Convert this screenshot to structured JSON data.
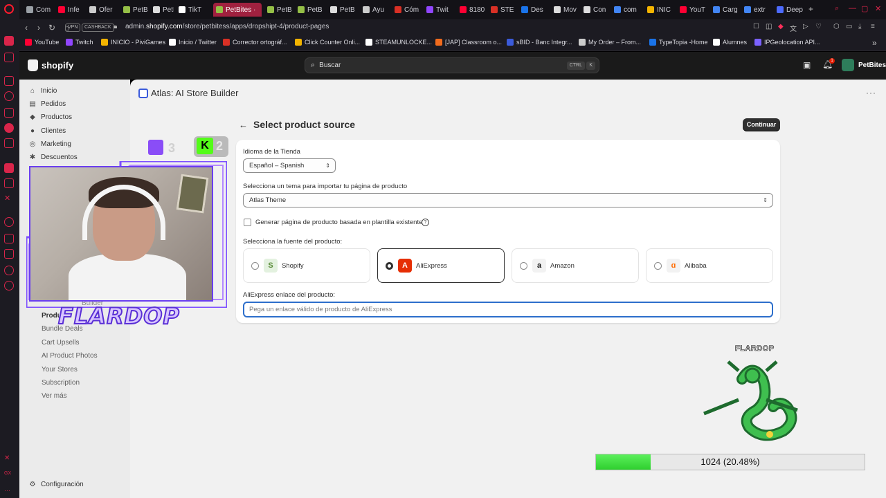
{
  "browser": {
    "tabs": [
      {
        "label": "Com",
        "active": false,
        "color": "#9aa0a6"
      },
      {
        "label": "Infe",
        "active": false,
        "color": "#ff0033"
      },
      {
        "label": "Ofer",
        "active": false,
        "color": "#cccccc"
      },
      {
        "label": "PetB",
        "active": false,
        "color": "#95bf47"
      },
      {
        "label": "PetB",
        "active": false,
        "color": "#dddddd"
      },
      {
        "label": "TikT",
        "active": false,
        "color": "#ffffff"
      },
      {
        "label": "PetBites ·",
        "active": true,
        "color": "#95bf47"
      },
      {
        "label": "PetB",
        "active": false,
        "color": "#95bf47"
      },
      {
        "label": "PetB",
        "active": false,
        "color": "#95bf47"
      },
      {
        "label": "PetB",
        "active": false,
        "color": "#dddddd"
      },
      {
        "label": "Ayu",
        "active": false,
        "color": "#cccccc"
      },
      {
        "label": "Cóm",
        "active": false,
        "color": "#d93025"
      },
      {
        "label": "Twit",
        "active": false,
        "color": "#9146ff"
      },
      {
        "label": "8180",
        "active": false,
        "color": "#ff0033"
      },
      {
        "label": "STE",
        "active": false,
        "color": "#d93025"
      },
      {
        "label": "Des",
        "active": false,
        "color": "#1a73e8"
      },
      {
        "label": "Mov",
        "active": false,
        "color": "#dddddd"
      },
      {
        "label": "Con",
        "active": false,
        "color": "#dddddd"
      },
      {
        "label": "com",
        "active": false,
        "color": "#4285f4"
      },
      {
        "label": "INIC",
        "active": false,
        "color": "#f4b400"
      },
      {
        "label": "YouT",
        "active": false,
        "color": "#ff0033"
      },
      {
        "label": "Carg",
        "active": false,
        "color": "#4285f4"
      },
      {
        "label": "extr",
        "active": false,
        "color": "#4285f4"
      },
      {
        "label": "Deep",
        "active": false,
        "color": "#4d6bfe"
      }
    ],
    "new_tab_label": "+",
    "badges": {
      "vpn": "VPN",
      "cashback": "CASHBACK"
    },
    "url_prefix": "admin.",
    "url_host": "shopify.com",
    "url_path": "/store/petbitess/apps/dropshipt-4/product-pages",
    "bookmarks": [
      {
        "label": "YouTube",
        "color": "#ff0033"
      },
      {
        "label": "Twitch",
        "color": "#9146ff"
      },
      {
        "label": "INICIO - PiviGames",
        "color": "#f4b400"
      },
      {
        "label": "Inicio / Twitter",
        "color": "#ffffff"
      },
      {
        "label": "Corrector ortográf...",
        "color": "#d93025"
      },
      {
        "label": "Click Counter Onli...",
        "color": "#f4b400"
      },
      {
        "label": "STEAMUNLOCKE...",
        "color": "#ffffff"
      },
      {
        "label": "[JAP] Classroom o...",
        "color": "#f26b1d"
      },
      {
        "label": "sBID - Banc Integr...",
        "color": "#3b5bdb"
      },
      {
        "label": "My Order – From...",
        "color": "#cccccc"
      },
      {
        "label": "TypeTopia -Home",
        "color": "#1a73e8"
      },
      {
        "label": "Alumnes",
        "color": "#ffffff"
      },
      {
        "label": "IPGeolocation API...",
        "color": "#7b61ff"
      }
    ]
  },
  "shopify": {
    "logo_text": "shopify",
    "search_placeholder": "Buscar",
    "search_kbd_1": "CTRL",
    "search_kbd_2": "K",
    "store_name": "PetBites",
    "notification_count": "1"
  },
  "nav": {
    "items": [
      {
        "label": "Inicio",
        "icon": "home-icon",
        "glyph": "⌂"
      },
      {
        "label": "Pedidos",
        "icon": "orders-icon",
        "glyph": "▤"
      },
      {
        "label": "Productos",
        "icon": "tag-icon",
        "glyph": "◆"
      },
      {
        "label": "Clientes",
        "icon": "person-icon",
        "glyph": "●"
      },
      {
        "label": "Marketing",
        "icon": "target-icon",
        "glyph": "◎"
      },
      {
        "label": "Descuentos",
        "icon": "discount-icon",
        "glyph": "✱"
      }
    ],
    "app_sub": [
      "Produ",
      "Bundle Deals",
      "Cart Upsells",
      "AI Product Photos",
      "Your Stores",
      "Subscription",
      "Ver más"
    ],
    "builder_label": "Builder",
    "settings": "Configuración"
  },
  "app": {
    "title": "Atlas: AI Store Builder",
    "more": "···",
    "page_title": "Select product source",
    "back_arrow": "←",
    "continue_label": "Continuar",
    "language_label": "Idioma de la Tienda",
    "language_value": "Español – Spanish",
    "theme_label": "Selecciona un tema para importar tu página de producto",
    "theme_value": "Atlas Theme",
    "template_checkbox_label": "Generar página de producto basada en plantilla existente",
    "help_glyph": "?",
    "source_label": "Selecciona la fuente del producto:",
    "sources": [
      {
        "name": "Shopify",
        "selected": false,
        "glyph": "S",
        "bg": "#e3f1df",
        "fg": "#5e8e3e"
      },
      {
        "name": "AliExpress",
        "selected": true,
        "glyph": "A",
        "bg": "#e62e04",
        "fg": "#ffffff"
      },
      {
        "name": "Amazon",
        "selected": false,
        "glyph": "a",
        "bg": "#f2f2f2",
        "fg": "#111111"
      },
      {
        "name": "Alibaba",
        "selected": false,
        "glyph": "ɑ",
        "bg": "#f2f2f2",
        "fg": "#ff6a00"
      }
    ],
    "link_label": "AliExpress enlace del producto:",
    "link_placeholder": "Pega un enlace válido de producto de AliExpress"
  },
  "overlay": {
    "streamer": "FLARDOP",
    "twitch_count": "3",
    "kick_count": "2",
    "kick_glyph": "K",
    "pokemon_label": "FLARDOP",
    "xp_text": "1024 (20.48%)",
    "xp_fraction": 0.2048
  }
}
